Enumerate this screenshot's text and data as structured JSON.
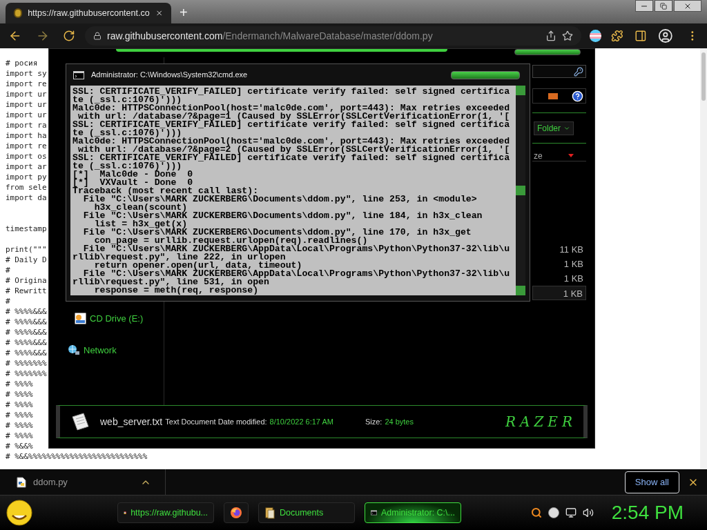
{
  "browser": {
    "tab": {
      "title": "https://raw.githubusercontent.co"
    },
    "new_tab": "+",
    "url": {
      "host": "raw.githubusercontent.com",
      "path": "/Endermanch/MalwareDatabase/master/ddom.py"
    }
  },
  "page": {
    "code_lines": [
      {
        "kind": "line",
        "text": "# росия"
      },
      {
        "kind": "line",
        "text": "import sy"
      },
      {
        "kind": "line",
        "text": "import re"
      },
      {
        "kind": "line",
        "text": "import ur"
      },
      {
        "kind": "line",
        "text": "import ur"
      },
      {
        "kind": "line",
        "text": "import ur"
      },
      {
        "kind": "line",
        "text": "import ra"
      },
      {
        "kind": "line",
        "text": "import ha"
      },
      {
        "kind": "line",
        "text": "import re"
      },
      {
        "kind": "line",
        "text": "import os"
      },
      {
        "kind": "line",
        "text": "import ar"
      },
      {
        "kind": "line",
        "text": "import py"
      },
      {
        "kind": "line",
        "text": "from sele"
      },
      {
        "kind": "line",
        "text": "import da"
      },
      {
        "kind": "blank"
      },
      {
        "kind": "blank"
      },
      {
        "kind": "line",
        "text": "timestamp"
      },
      {
        "kind": "blank"
      },
      {
        "kind": "line",
        "text": "print(\"\"\""
      },
      {
        "kind": "line",
        "text": "# Daily D"
      },
      {
        "kind": "line",
        "text": "#"
      },
      {
        "kind": "line",
        "text": "# Origina"
      },
      {
        "kind": "line",
        "text": "# Rewritt"
      },
      {
        "kind": "line",
        "text": "#"
      },
      {
        "kind": "line",
        "text": "# %%%%&&&"
      },
      {
        "kind": "line",
        "text": "# %%%%&&&"
      },
      {
        "kind": "line",
        "text": "# %%%%&&&"
      },
      {
        "kind": "line",
        "text": "# %%%%&&&"
      },
      {
        "kind": "line",
        "text": "# %%%%&&&"
      },
      {
        "kind": "line",
        "text": "# %%%%%%%"
      },
      {
        "kind": "line",
        "text": "# %%%%%%%"
      },
      {
        "kind": "line",
        "text": "# %%%%"
      },
      {
        "kind": "line",
        "text": "# %%%%"
      },
      {
        "kind": "line",
        "text": "# %%%%"
      },
      {
        "kind": "line",
        "text": "# %%%%"
      },
      {
        "kind": "line",
        "text": "# %%%%"
      },
      {
        "kind": "line",
        "text": "# %%%%"
      },
      {
        "kind": "line",
        "text": "# %&&%"
      },
      {
        "kind": "line",
        "text": "# %&&%%%%%%%%%%%%%%%%%%%%%%%%%%"
      }
    ]
  },
  "explorer": {
    "view_button": "Folder",
    "column_header": "ze",
    "sizes": [
      {
        "text": "11 KB",
        "selected": false
      },
      {
        "text": "1 KB",
        "selected": false
      },
      {
        "text": "1 KB",
        "selected": false
      },
      {
        "text": "1 KB",
        "selected": true
      }
    ],
    "nav": [
      {
        "kind": "drive",
        "label": "CD Drive (E:)"
      },
      {
        "kind": "network",
        "label": "Network"
      }
    ],
    "details": {
      "file_name": "web_server.txt",
      "file_type": "Text Document",
      "date_label": "Date modified:",
      "date": "8/10/2022 6:17 AM",
      "size_label": "Size:",
      "size": "24 bytes"
    },
    "logo": "RAZER"
  },
  "cmd": {
    "title": "Administrator: C:\\Windows\\System32\\cmd.exe",
    "lines": [
      "SSL: CERTIFICATE_VERIFY_FAILED] certificate verify failed: self signed certifica",
      "te (_ssl.c:1076)')))",
      "Malc0de: HTTPSConnectionPool(host='malc0de.com', port=443): Max retries exceeded",
      " with url: /database/?&page=1 (Caused by SSLError(SSLCertVerificationError(1, '[",
      "SSL: CERTIFICATE_VERIFY_FAILED] certificate verify failed: self signed certifica",
      "te (_ssl.c:1076)')))",
      "Malc0de: HTTPSConnectionPool(host='malc0de.com', port=443): Max retries exceeded",
      " with url: /database/?&page=2 (Caused by SSLError(SSLCertVerificationError(1, '[",
      "SSL: CERTIFICATE_VERIFY_FAILED] certificate verify failed: self signed certifica",
      "te (_ssl.c:1076)')))",
      "[*]  Malc0de - Done  0",
      "[*]  VXVault - Done  0",
      "Traceback (most recent call last):",
      "  File \"C:\\Users\\MARK ZUCKERBERG\\Documents\\ddom.py\", line 253, in <module>",
      "    h3x_clean(scount)",
      "  File \"C:\\Users\\MARK ZUCKERBERG\\Documents\\ddom.py\", line 184, in h3x_clean",
      "    list = h3x_get(x)",
      "  File \"C:\\Users\\MARK ZUCKERBERG\\Documents\\ddom.py\", line 170, in h3x_get",
      "    con_page = urllib.request.urlopen(req).readlines()",
      "  File \"C:\\Users\\MARK ZUCKERBERG\\AppData\\Local\\Programs\\Python\\Python37-32\\lib\\u",
      "rllib\\request.py\", line 222, in urlopen",
      "    return opener.open(url, data, timeout)",
      "  File \"C:\\Users\\MARK ZUCKERBERG\\AppData\\Local\\Programs\\Python\\Python37-32\\lib\\u",
      "rllib\\request.py\", line 531, in open",
      "    response = meth(req, response)"
    ]
  },
  "downloads": {
    "items": [
      {
        "name": "ddom.py"
      }
    ],
    "show_all": "Show all"
  },
  "taskbar": {
    "buttons": [
      {
        "kind": "chrome",
        "label": "https://raw.githubu...",
        "selected": false
      },
      {
        "kind": "firefox",
        "selected": false
      },
      {
        "kind": "folder",
        "label": "Documents",
        "selected": false
      },
      {
        "kind": "cmd",
        "label": "Administrator: C:\\...",
        "selected": true
      }
    ],
    "clock": "2:54 PM"
  }
}
